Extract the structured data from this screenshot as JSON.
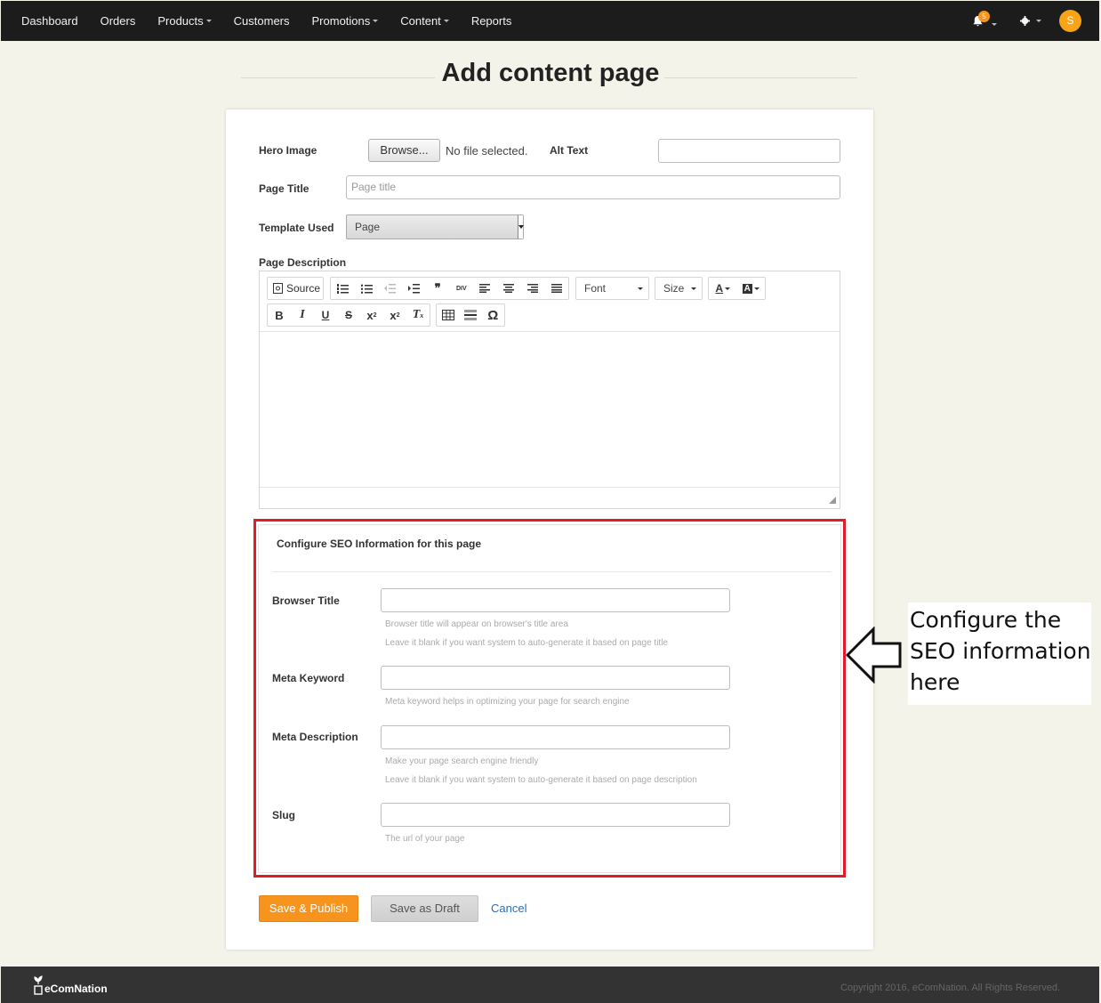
{
  "nav": {
    "items": [
      {
        "label": "Dashboard",
        "caret": false
      },
      {
        "label": "Orders",
        "caret": false
      },
      {
        "label": "Products",
        "caret": true
      },
      {
        "label": "Customers",
        "caret": false
      },
      {
        "label": "Promotions",
        "caret": true
      },
      {
        "label": "Content",
        "caret": true
      },
      {
        "label": "Reports",
        "caret": false
      }
    ],
    "notification_count": "5",
    "avatar_initial": "S"
  },
  "page": {
    "title": "Add content page"
  },
  "form": {
    "hero_image_label": "Hero Image",
    "browse_label": "Browse...",
    "no_file": "No file selected.",
    "alt_text_label": "Alt Text",
    "alt_text_value": "",
    "page_title_label": "Page Title",
    "page_title_placeholder": "Page title",
    "template_label": "Template Used",
    "template_value": "Page",
    "description_label": "Page Description"
  },
  "editor": {
    "source_label": "Source",
    "font_label": "Font",
    "size_label": "Size"
  },
  "seo": {
    "title": "Configure SEO Information for this page",
    "browser_title_label": "Browser Title",
    "browser_title_help1": "Browser title will appear on browser's title area",
    "browser_title_help2": "Leave it blank if you want system to auto-generate it based on page title",
    "meta_keyword_label": "Meta Keyword",
    "meta_keyword_help": "Meta keyword helps in optimizing your page for search engine",
    "meta_description_label": "Meta Description",
    "meta_description_help1": "Make your page search engine friendly",
    "meta_description_help2": "Leave it blank if you want system to auto-generate it based on page description",
    "slug_label": "Slug",
    "slug_help": "The url of your page"
  },
  "actions": {
    "publish": "Save & Publish",
    "draft": "Save as Draft",
    "cancel": "Cancel"
  },
  "annotation": {
    "lines": [
      "Configure the",
      "SEO information",
      "here"
    ],
    "outline_color": "#e4192a"
  },
  "footer": {
    "brand": "eComNation",
    "copyright": "Copyright 2016, eComNation. All Rights Reserved."
  },
  "colors": {
    "accent": "#f7941d",
    "link": "#2a6db3",
    "nav_bg": "#1c1c1c"
  }
}
